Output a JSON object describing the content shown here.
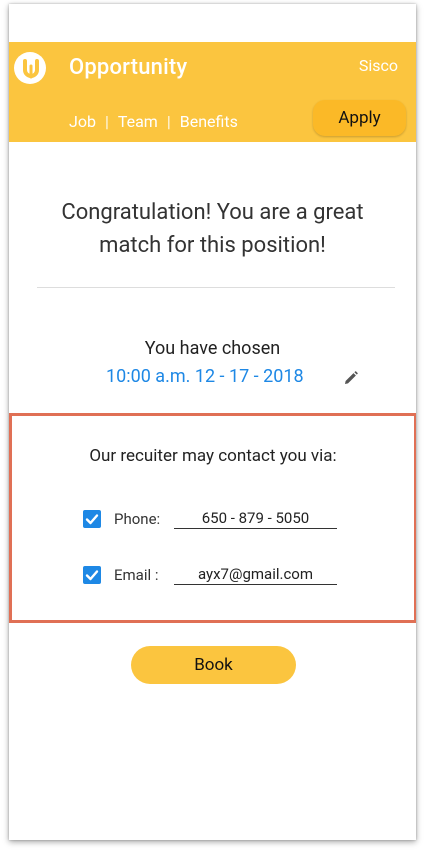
{
  "header": {
    "app_title": "Opportunity",
    "company": "Sisco",
    "nav": [
      {
        "label": "Job"
      },
      {
        "label": "Team"
      },
      {
        "label": "Benefits"
      }
    ],
    "separator": "|",
    "apply_label": "Apply"
  },
  "main": {
    "congrats_line1": "Congratulation! You are a great",
    "congrats_line2": "match for this position!",
    "chosen_label": "You have chosen",
    "chosen_value": "10:00 a.m. 12 - 17 - 2018"
  },
  "contact": {
    "title": "Our recuiter may contact you via:",
    "phone": {
      "label": "Phone:",
      "value": "650 - 879 - 5050",
      "checked": true
    },
    "email": {
      "label": "Email :",
      "value": "ayx7@gmail.com",
      "checked": true
    }
  },
  "book_label": "Book",
  "colors": {
    "brand": "#fbc53f",
    "apply": "#fbb927",
    "link": "#1e88e5",
    "highlight_border": "#e07055"
  }
}
